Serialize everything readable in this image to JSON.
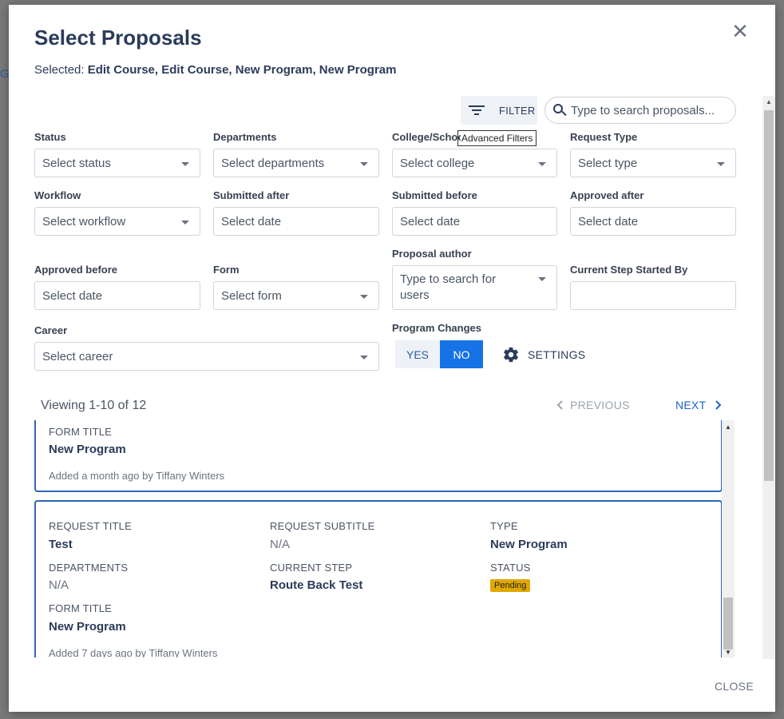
{
  "background": {
    "partial_letter": "G"
  },
  "dialog": {
    "title": "Select Proposals",
    "selected_prefix": "Selected:",
    "selected_items": "Edit Course, Edit Course, New Program, New Program",
    "close_button": "CLOSE"
  },
  "toolbar": {
    "filter_label": "FILTER",
    "filter_tooltip": "Advanced Filters",
    "search_placeholder": "Type to search proposals..."
  },
  "filters": {
    "status": {
      "label": "Status",
      "placeholder": "Select status"
    },
    "departments": {
      "label": "Departments",
      "placeholder": "Select departments"
    },
    "college": {
      "label": "College/School",
      "placeholder": "Select college"
    },
    "request_type": {
      "label": "Request Type",
      "placeholder": "Select type"
    },
    "workflow": {
      "label": "Workflow",
      "placeholder": "Select workflow"
    },
    "submitted_after": {
      "label": "Submitted after",
      "placeholder": "Select date"
    },
    "submitted_before": {
      "label": "Submitted before",
      "placeholder": "Select date"
    },
    "approved_after": {
      "label": "Approved after",
      "placeholder": "Select date"
    },
    "approved_before": {
      "label": "Approved before",
      "placeholder": "Select date"
    },
    "form": {
      "label": "Form",
      "placeholder": "Select form"
    },
    "proposal_author": {
      "label": "Proposal author",
      "placeholder": "Type to search for users"
    },
    "current_step_started_by": {
      "label": "Current Step Started By",
      "placeholder": ""
    },
    "career": {
      "label": "Career",
      "placeholder": "Select career"
    },
    "program_changes": {
      "label": "Program Changes",
      "yes": "YES",
      "no": "NO",
      "selected": "NO"
    },
    "settings_label": "SETTINGS"
  },
  "pagination": {
    "viewing": "Viewing 1-10 of 12",
    "previous": "PREVIOUS",
    "next": "NEXT"
  },
  "labels": {
    "request_title": "REQUEST TITLE",
    "request_subtitle": "REQUEST SUBTITLE",
    "type": "TYPE",
    "departments": "DEPARTMENTS",
    "current_step": "CURRENT STEP",
    "status": "STATUS",
    "form_title": "FORM TITLE"
  },
  "proposals": [
    {
      "form_title": "New Program",
      "added": "Added a month ago by Tiffany Winters"
    },
    {
      "request_title": "Test",
      "request_subtitle": "N/A",
      "type": "New Program",
      "departments": "N/A",
      "current_step": "Route Back Test",
      "status": "Pending",
      "form_title": "New Program",
      "added": "Added 7 days ago by Tiffany Winters"
    }
  ],
  "colors": {
    "primary": "#1573e6",
    "title_text": "#2b3c5a",
    "card_border": "#2b68b0",
    "pending_badge": "#e0a800"
  }
}
